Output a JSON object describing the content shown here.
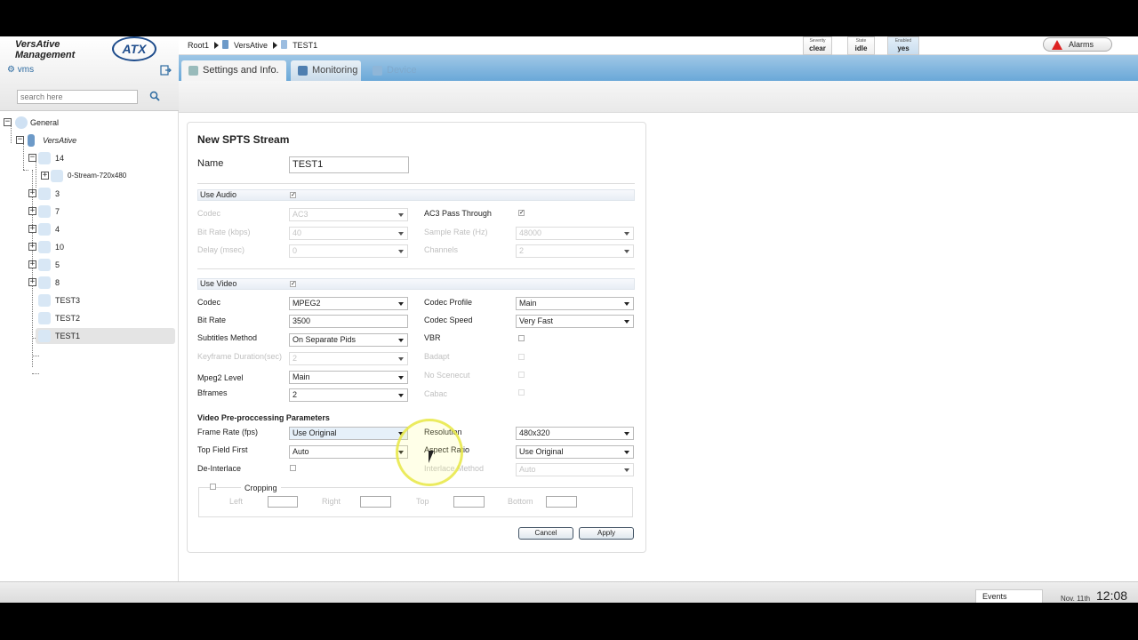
{
  "brand": {
    "line1": "VersAtive",
    "line2": "Management",
    "logo": "ATX",
    "user": "vms"
  },
  "search": {
    "placeholder": "search here"
  },
  "tree": {
    "root": "General",
    "device": "VersAtive",
    "node_14": "14",
    "stream": "0-Stream-720x480",
    "items": [
      "3",
      "7",
      "4",
      "10",
      "5",
      "8",
      "TEST3",
      "TEST2",
      "TEST1"
    ]
  },
  "breadcrumb": {
    "root": "Root1",
    "device": "VersAtive",
    "current": "TEST1"
  },
  "status": {
    "severity": {
      "label": "Severity",
      "value": "clear"
    },
    "state": {
      "label": "State",
      "value": "idle"
    },
    "enabled": {
      "label": "Enabled",
      "value": "yes"
    }
  },
  "alarms": "Alarms",
  "tabs": {
    "settings": "Settings and Info.",
    "monitoring": "Monitoring",
    "device": "Device"
  },
  "form": {
    "title": "New SPTS Stream",
    "name_label": "Name",
    "name_value": "TEST1",
    "audio": {
      "section": "Use Audio",
      "codec_label": "Codec",
      "codec_value": "AC3",
      "passthrough_label": "AC3 Pass Through",
      "bitrate_label": "Bit Rate (kbps)",
      "bitrate_value": "40",
      "samplerate_label": "Sample Rate (Hz)",
      "samplerate_value": "48000",
      "delay_label": "Delay (msec)",
      "delay_value": "0",
      "channels_label": "Channels",
      "channels_value": "2"
    },
    "video": {
      "section": "Use Video",
      "codec_label": "Codec",
      "codec_value": "MPEG2",
      "profile_label": "Codec Profile",
      "profile_value": "Main",
      "bitrate_label": "Bit Rate",
      "bitrate_value": "3500",
      "speed_label": "Codec Speed",
      "speed_value": "Very Fast",
      "subtitles_label": "Subtitles Method",
      "subtitles_value": "On Separate Pids",
      "vbr_label": "VBR",
      "keyframe_label": "Keyframe Duration(sec)",
      "keyframe_value": "2",
      "badapt_label": "Badapt",
      "mpeg2level_label": "Mpeg2 Level",
      "mpeg2level_value": "Main",
      "noscenecut_label": "No Scenecut",
      "bframes_label": "Bframes",
      "bframes_value": "2",
      "cabac_label": "Cabac"
    },
    "prep": {
      "section": "Video Pre-proccessing Parameters",
      "framerate_label": "Frame Rate (fps)",
      "framerate_value": "Use Original",
      "resolution_label": "Resolution",
      "resolution_value": "480x320",
      "topfield_label": "Top Field First",
      "topfield_value": "Auto",
      "aspect_label": "Aspect Ratio",
      "aspect_value": "Use Original",
      "deinterlace_label": "De-Interlace",
      "deint_method_label": "Interlace Method",
      "deint_method_value": "Auto"
    },
    "cropping": {
      "label": "Cropping",
      "left": "Left",
      "right": "Right",
      "top": "Top",
      "bottom": "Bottom"
    },
    "cancel": "Cancel",
    "apply": "Apply"
  },
  "footer": {
    "events": "Events",
    "date": "Nov. 11th",
    "time": "12:08"
  },
  "colors": {
    "accent": "#6aa8d8",
    "alarm": "#dd2222",
    "highlight": "#e8e846"
  }
}
